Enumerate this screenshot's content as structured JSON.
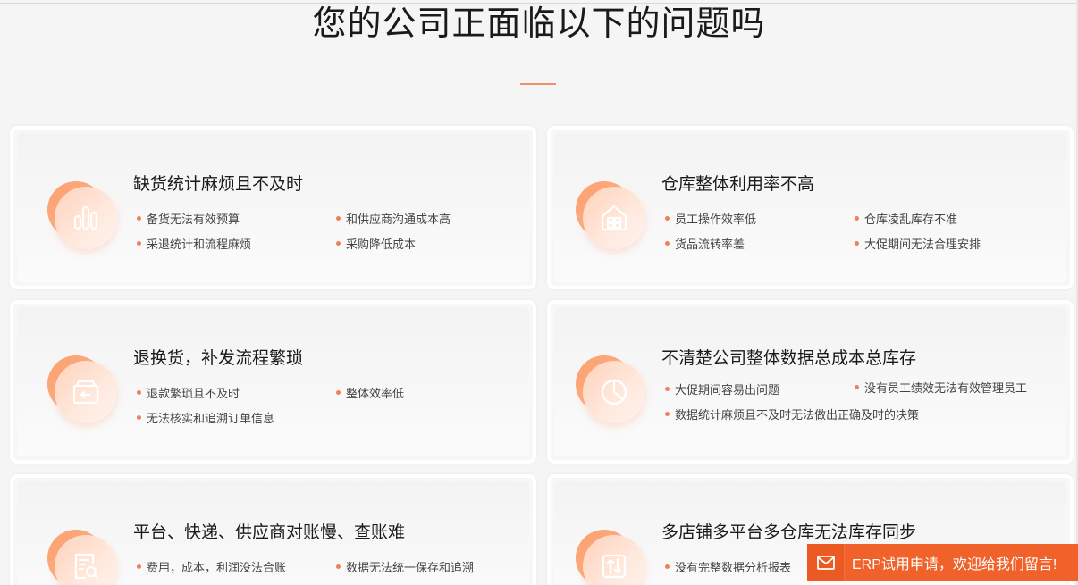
{
  "page": {
    "title": "您的公司正面临以下的问题吗",
    "accent_color": "#f0805a"
  },
  "cards": [
    {
      "title": "缺货统计麻烦且不及时",
      "icon": "bar-chart-icon",
      "col1": [
        "备货无法有效预算",
        "采退统计和流程麻烦"
      ],
      "col2": [
        "和供应商沟通成本高",
        "采购降低成本"
      ]
    },
    {
      "title": "仓库整体利用率不高",
      "icon": "warehouse-icon",
      "col1": [
        "员工操作效率低",
        "货品流转率差"
      ],
      "col2": [
        "仓库凌乱库存不准",
        "大促期间无法合理安排"
      ]
    },
    {
      "title": "退换货，补发流程繁琐",
      "icon": "return-box-icon",
      "col1": [
        "退款繁琐且不及时",
        "无法核实和追溯订单信息"
      ],
      "col2": [
        "整体效率低"
      ]
    },
    {
      "title": "不清楚公司整体数据总成本总库存",
      "icon": "pie-chart-icon",
      "col1": [
        "大促期间容易出问题",
        "数据统计麻烦且不及时无法做出正确及时的决策"
      ],
      "col2": [
        "没有员工绩效无法有效管理员工"
      ]
    },
    {
      "title": "平台、快递、供应商对账慢、查账难",
      "icon": "document-search-icon",
      "col1": [
        "费用，成本，利润没法合账"
      ],
      "col2": [
        "数据无法统一保存和追溯"
      ]
    },
    {
      "title": "多店铺多平台多仓库无法库存同步",
      "icon": "sync-arrows-icon",
      "col1": [
        "没有完整数据分析报表"
      ],
      "col2": []
    }
  ],
  "chat": {
    "label": "ERP试用申请，欢迎给我们留言!",
    "icon": "mail-icon",
    "color": "#f0622a"
  }
}
